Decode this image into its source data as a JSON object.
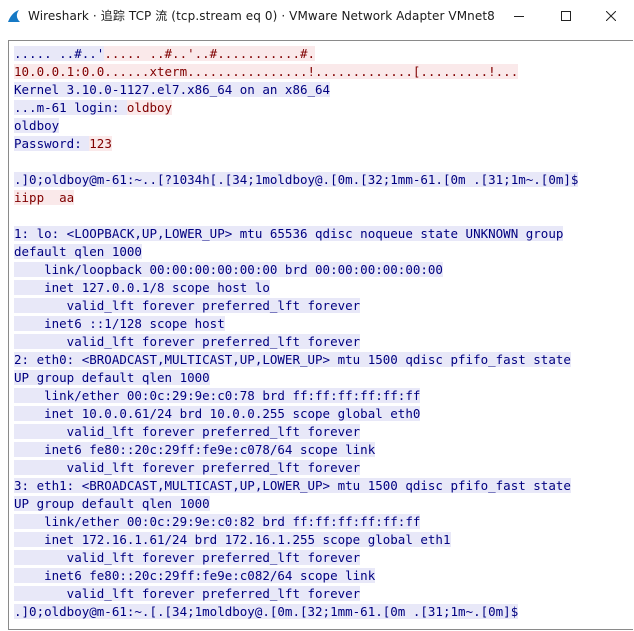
{
  "window": {
    "title": "Wireshark · 追踪 TCP 流 (tcp.stream eq 0) · VMware Network Adapter VMnet8",
    "icon": "wireshark-fin-icon",
    "controls": [
      "minimize-icon",
      "maximize-icon",
      "close-icon"
    ]
  },
  "colors": {
    "client_bg": "#fae9ea",
    "client_fg": "#800000",
    "server_bg": "#e8e8f8",
    "server_fg": "#000080"
  },
  "stream_lines": [
    [
      {
        "t": "..... ..#..'",
        "k": "s"
      },
      {
        "t": "..... ..#..'..#...........#.",
        "k": "c"
      }
    ],
    [
      {
        "t": "10.0.0.1:0.0......xterm................!.............[.........!...",
        "k": "c"
      }
    ],
    [
      {
        "t": "Kernel 3.10.0-1127.el7.x86_64 on an x86_64",
        "k": "s"
      }
    ],
    [
      {
        "t": "...m-61 login: ",
        "k": "s"
      },
      {
        "t": "oldboy",
        "k": "c"
      }
    ],
    [
      {
        "t": "oldboy",
        "k": "s"
      }
    ],
    [
      {
        "t": "Password: ",
        "k": "s"
      },
      {
        "t": "123",
        "k": "c"
      }
    ],
    [],
    [
      {
        "t": ".]0;oldboy@m-61:~..[?1034h[.[34;1moldboy@.[0m.[32;1mm-61.[0m .[31;1m~.[0m]$",
        "k": "s"
      }
    ],
    [
      {
        "t": "iipp  aa",
        "k": "c"
      }
    ],
    [],
    [
      {
        "t": "1: lo: <LOOPBACK,UP,LOWER_UP> mtu 65536 qdisc noqueue state UNKNOWN group",
        "k": "s"
      }
    ],
    [
      {
        "t": "default qlen 1000",
        "k": "s"
      }
    ],
    [
      {
        "t": "    link/loopback 00:00:00:00:00:00 brd 00:00:00:00:00:00",
        "k": "s"
      }
    ],
    [
      {
        "t": "    inet 127.0.0.1/8 scope host lo",
        "k": "s"
      }
    ],
    [
      {
        "t": "       valid_lft forever preferred_lft forever",
        "k": "s"
      }
    ],
    [
      {
        "t": "    inet6 ::1/128 scope host",
        "k": "s"
      }
    ],
    [
      {
        "t": "       valid_lft forever preferred_lft forever",
        "k": "s"
      }
    ],
    [
      {
        "t": "2: eth0: <BROADCAST,MULTICAST,UP,LOWER_UP> mtu 1500 qdisc pfifo_fast state",
        "k": "s"
      }
    ],
    [
      {
        "t": "UP group default qlen 1000",
        "k": "s"
      }
    ],
    [
      {
        "t": "    link/ether 00:0c:29:9e:c0:78 brd ff:ff:ff:ff:ff:ff",
        "k": "s"
      }
    ],
    [
      {
        "t": "    inet 10.0.0.61/24 brd 10.0.0.255 scope global eth0",
        "k": "s"
      }
    ],
    [
      {
        "t": "       valid_lft forever preferred_lft forever",
        "k": "s"
      }
    ],
    [
      {
        "t": "    inet6 fe80::20c:29ff:fe9e:c078/64 scope link",
        "k": "s"
      }
    ],
    [
      {
        "t": "       valid_lft forever preferred_lft forever",
        "k": "s"
      }
    ],
    [
      {
        "t": "3: eth1: <BROADCAST,MULTICAST,UP,LOWER_UP> mtu 1500 qdisc pfifo_fast state",
        "k": "s"
      }
    ],
    [
      {
        "t": "UP group default qlen 1000",
        "k": "s"
      }
    ],
    [
      {
        "t": "    link/ether 00:0c:29:9e:c0:82 brd ff:ff:ff:ff:ff:ff",
        "k": "s"
      }
    ],
    [
      {
        "t": "    inet 172.16.1.61/24 brd 172.16.1.255 scope global eth1",
        "k": "s"
      }
    ],
    [
      {
        "t": "       valid_lft forever preferred_lft forever",
        "k": "s"
      }
    ],
    [
      {
        "t": "    inet6 fe80::20c:29ff:fe9e:c082/64 scope link",
        "k": "s"
      }
    ],
    [
      {
        "t": "       valid_lft forever preferred_lft forever",
        "k": "s"
      }
    ],
    [
      {
        "t": ".]0;oldboy@m-61:~.[.[34;1moldboy@.[0m.[32;1mm-61.[0m .[31;1m~.[0m]$",
        "k": "s"
      }
    ]
  ]
}
